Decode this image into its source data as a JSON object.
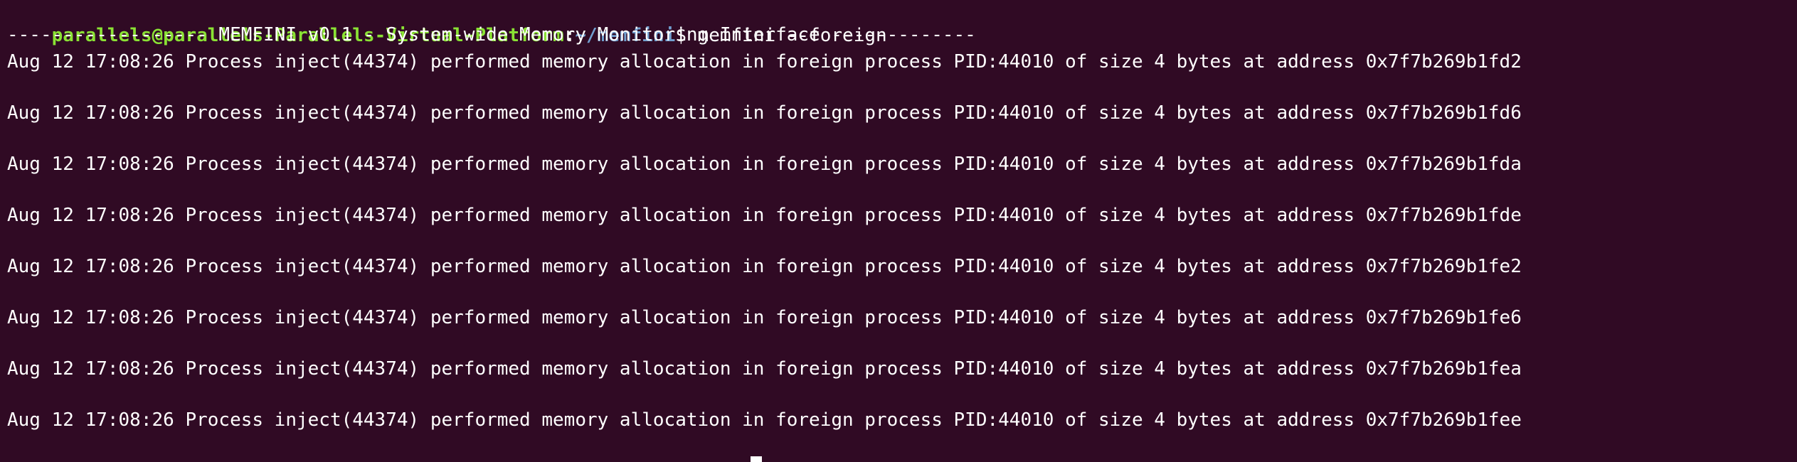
{
  "terminal": {
    "prompt": {
      "user_host": "parallels@parallels-Parallels-Virtual-Platform",
      "separator": ":",
      "path": "~/memfini",
      "dollar": "$ ",
      "command": "memfini --foreign"
    },
    "banner": "------------------ MEMFINI v0.1 - System-wide Memory Monitoring Interface -------------",
    "log_lines": [
      "Aug 12 17:08:26 Process inject(44374) performed memory allocation in foreign process PID:44010 of size 4 bytes at address 0x7f7b269b1fd2",
      "Aug 12 17:08:26 Process inject(44374) performed memory allocation in foreign process PID:44010 of size 4 bytes at address 0x7f7b269b1fd6",
      "Aug 12 17:08:26 Process inject(44374) performed memory allocation in foreign process PID:44010 of size 4 bytes at address 0x7f7b269b1fda",
      "Aug 12 17:08:26 Process inject(44374) performed memory allocation in foreign process PID:44010 of size 4 bytes at address 0x7f7b269b1fde",
      "Aug 12 17:08:26 Process inject(44374) performed memory allocation in foreign process PID:44010 of size 4 bytes at address 0x7f7b269b1fe2",
      "Aug 12 17:08:26 Process inject(44374) performed memory allocation in foreign process PID:44010 of size 4 bytes at address 0x7f7b269b1fe6",
      "Aug 12 17:08:26 Process inject(44374) performed memory allocation in foreign process PID:44010 of size 4 bytes at address 0x7f7b269b1fea",
      "Aug 12 17:08:26 Process inject(44374) performed memory allocation in foreign process PID:44010 of size 4 bytes at address 0x7f7b269b1fee"
    ],
    "colors": {
      "background": "#300a24",
      "user_host": "#8ae234",
      "path": "#729fcf",
      "text": "#ffffff"
    }
  }
}
